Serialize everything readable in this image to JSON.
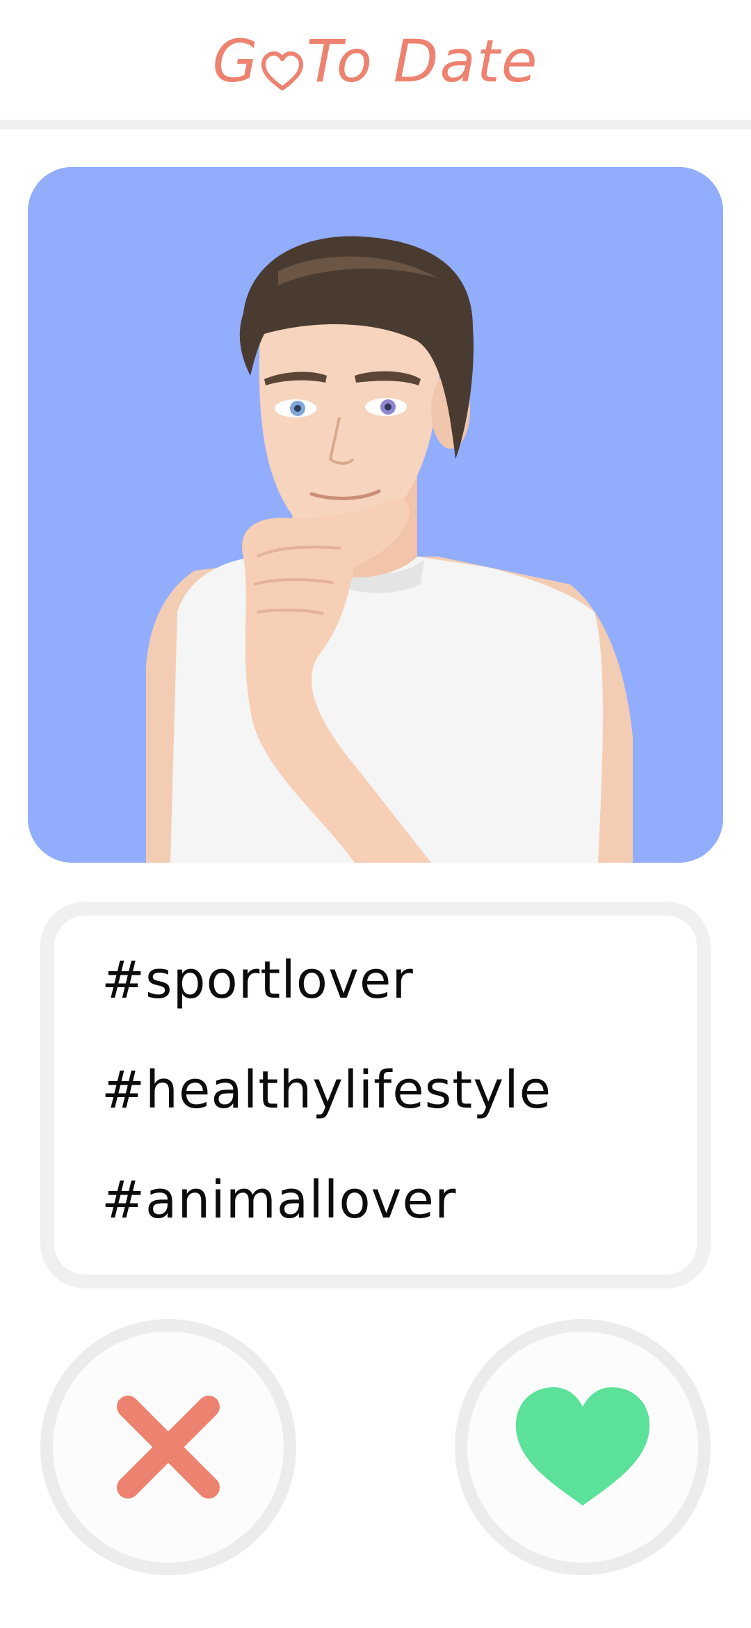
{
  "header": {
    "brand_part1": "G",
    "brand_part2": " To Date",
    "brand_icon": "heart-outline-icon",
    "brand_color": "#ee8270"
  },
  "profile": {
    "photo_background": "#93adfd",
    "photo_subject": "avatar-portrait"
  },
  "tags": [
    "#sportlover",
    "#healthylifestyle",
    "#animallover"
  ],
  "actions": {
    "dislike": {
      "icon": "close-icon",
      "color": "#ee8270"
    },
    "like": {
      "icon": "heart-icon",
      "color": "#5be19a"
    }
  }
}
